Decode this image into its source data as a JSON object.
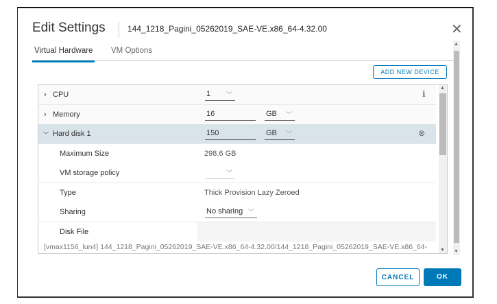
{
  "dialog": {
    "title": "Edit Settings",
    "subtitle": "144_1218_Pagini_05262019_SAE-VE.x86_64-4.32.00",
    "close": "✕"
  },
  "tabs": [
    {
      "label": "Virtual Hardware"
    },
    {
      "label": "VM Options"
    }
  ],
  "add_device": "ADD NEW DEVICE",
  "rows": {
    "cpu": {
      "label": "CPU",
      "value": "1"
    },
    "memory": {
      "label": "Memory",
      "value": "16",
      "unit": "GB"
    },
    "disk": {
      "label": "Hard disk 1",
      "value": "150",
      "unit": "GB"
    },
    "max_size": {
      "label": "Maximum Size",
      "value": "298.6 GB"
    },
    "policy": {
      "label": "VM storage policy",
      "value": ""
    },
    "type": {
      "label": "Type",
      "value": "Thick Provision Lazy Zeroed"
    },
    "sharing": {
      "label": "Sharing",
      "value": "No sharing"
    },
    "disk_file": {
      "label": "Disk File",
      "value": "[vmax1156_lun4] 144_1218_Pagini_05262019_SAE-VE.x86_64-4.32.00/144_1218_Pagini_05262019_SAE-VE.x86_64-"
    }
  },
  "footer": {
    "cancel": "CANCEL",
    "ok": "OK"
  }
}
